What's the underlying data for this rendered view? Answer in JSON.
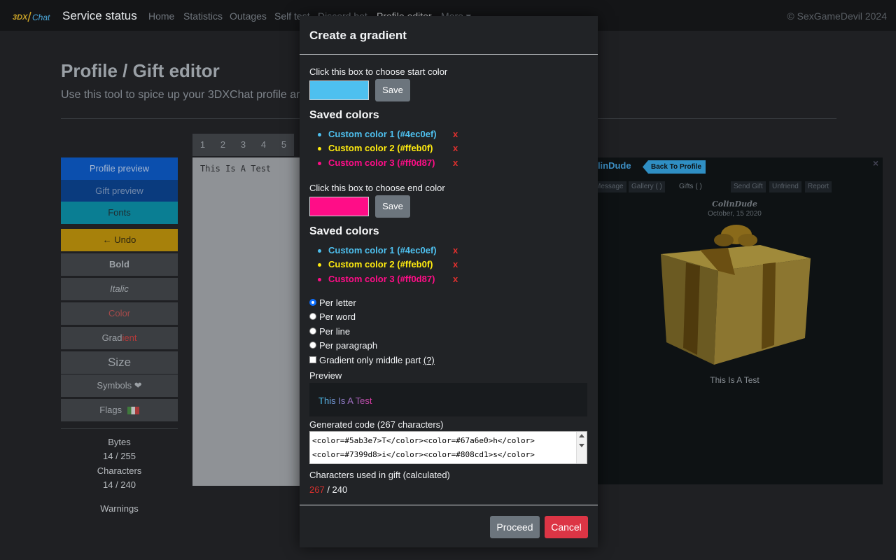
{
  "navbar": {
    "logo_text": "3DX Chat",
    "brand": "Service status",
    "links": [
      "Home",
      "Statistics",
      "Outages",
      "Self test",
      "Discord bot",
      "Profile editor",
      "More ▾"
    ],
    "copyright": "© SexGameDevil 2024"
  },
  "page": {
    "title": "Profile / Gift editor",
    "subtitle": "Use this tool to spice up your 3DXChat profile ar"
  },
  "sidebar": {
    "profile_preview": "Profile preview",
    "gift_preview": "Gift preview",
    "fonts": "Fonts",
    "undo": "← Undo",
    "bold": "Bold",
    "italic": "Italic",
    "color": "Color",
    "gradient_a": "Grad",
    "gradient_b": "ient",
    "size": "Size",
    "symbols": "Symbols ❤",
    "flags": "Flags"
  },
  "stats": {
    "bytes_label": "Bytes",
    "bytes_value": "14 / 255",
    "chars_label": "Characters",
    "chars_value": "14 / 240",
    "warnings_label": "Warnings"
  },
  "editor": {
    "tabs": [
      "1",
      "2",
      "3",
      "4",
      "5"
    ],
    "text": "This Is A Test"
  },
  "gift_preview": {
    "name_partial": "olinDude",
    "back_button": "Back To Profile",
    "tabs": [
      "Message",
      "Gallery ( )",
      "Gifts ( )",
      "Send Gift",
      "Unfriend",
      "Report"
    ],
    "sender": "ColinDude",
    "date": "October, 15 2020",
    "message": "This Is A Test"
  },
  "modal": {
    "title": "Create a gradient",
    "start_label": "Click this box to choose start color",
    "start_color": "#4ec0ef",
    "end_label": "Click this box to choose end color",
    "end_color": "#ff0d87",
    "save_label": "Save",
    "saved_heading": "Saved colors",
    "saved_colors": [
      {
        "label": "Custom color 1 (#4ec0ef)",
        "color": "#4ec0ef"
      },
      {
        "label": "Custom color 2 (#ffeb0f)",
        "color": "#ffeb0f"
      },
      {
        "label": "Custom color 3 (#ff0d87)",
        "color": "#ff0d87"
      }
    ],
    "delete_symbol": "x",
    "options": [
      "Per letter",
      "Per word",
      "Per line",
      "Per paragraph"
    ],
    "selected_option": "Per letter",
    "middle_only_label": "Gradient only middle part",
    "middle_only_help": "(?)",
    "preview_label": "Preview",
    "preview_text": "This Is A Test",
    "code_label": "Generated code (267 characters)",
    "code_lines": [
      "<color=#5ab3e7>T</color><color=#67a6e0>h</color>",
      "<color=#7399d8>i</color><color=#808cd1>s</color>"
    ],
    "chars_label": "Characters used in gift (calculated)",
    "chars_used": "267",
    "chars_max": " / 240",
    "proceed": "Proceed",
    "cancel": "Cancel"
  }
}
